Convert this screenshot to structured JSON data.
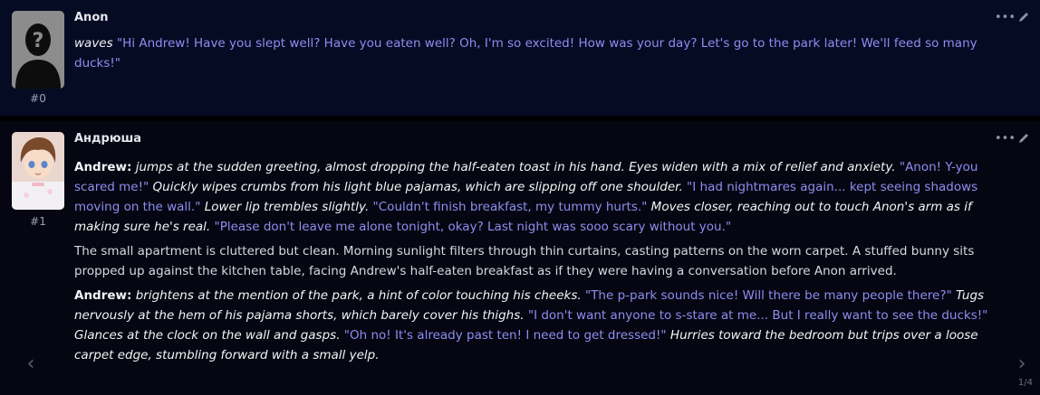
{
  "colors": {
    "user_bg": "#060b24",
    "char_bg": "#050611",
    "quote": "#8f8df0",
    "text": "#d5d8e0"
  },
  "messages": [
    {
      "name": "Anon",
      "number": "#0",
      "avatar_icon": "unknown-user-silhouette-icon",
      "tools": [
        "more-icon",
        "edit-pencil-icon"
      ],
      "segments": [
        [
          {
            "style": "em",
            "text": "waves"
          },
          {
            "style": "plain",
            "text": " "
          },
          {
            "style": "q",
            "text": "\"Hi Andrew! Have you slept well? Have you eaten well? Oh, I'm so excited! How was your day? Let's go to the park later! We'll feed so many ducks!\""
          }
        ]
      ]
    },
    {
      "name": "Андрюша",
      "number": "#1",
      "avatar_icon": "anime-boy-avatar-icon",
      "tools": [
        "more-icon",
        "edit-pencil-icon"
      ],
      "segments": [
        [
          {
            "style": "b",
            "text": "Andrew:"
          },
          {
            "style": "em",
            "text": " jumps at the sudden greeting, almost dropping the half-eaten toast in his hand. Eyes widen with a mix of relief and anxiety. "
          },
          {
            "style": "q",
            "text": "\"Anon! Y-you scared me!\""
          },
          {
            "style": "em",
            "text": " Quickly wipes crumbs from his light blue pajamas, which are slipping off one shoulder. "
          },
          {
            "style": "q",
            "text": "\"I had nightmares again... kept seeing shadows moving on the wall.\""
          },
          {
            "style": "em",
            "text": " Lower lip trembles slightly. "
          },
          {
            "style": "q",
            "text": "\"Couldn't finish breakfast, my tummy hurts.\""
          },
          {
            "style": "em",
            "text": " Moves closer, reaching out to touch Anon's arm as if making sure he's real. "
          },
          {
            "style": "q",
            "text": "\"Please don't leave me alone tonight, okay? Last night was sooo scary without you.\""
          }
        ],
        [
          {
            "style": "plain",
            "text": "The small apartment is cluttered but clean. Morning sunlight filters through thin curtains, casting patterns on the worn carpet. A stuffed bunny sits propped up against the kitchen table, facing Andrew's half-eaten breakfast as if they were having a conversation before Anon arrived."
          }
        ],
        [
          {
            "style": "b",
            "text": "Andrew:"
          },
          {
            "style": "em",
            "text": " brightens at the mention of the park, a hint of color touching his cheeks. "
          },
          {
            "style": "q",
            "text": "\"The p-park sounds nice! Will there be many people there?\""
          },
          {
            "style": "em",
            "text": " Tugs nervously at the hem of his pajama shorts, which barely cover his thighs. "
          },
          {
            "style": "q",
            "text": "\"I don't want anyone to s-stare at me... But I really want to see the ducks!\""
          },
          {
            "style": "em",
            "text": " Glances at the clock on the wall and gasps. "
          },
          {
            "style": "q",
            "text": "\"Oh no! It's already past ten! I need to get dressed!\""
          },
          {
            "style": "em",
            "text": " Hurries toward the bedroom but trips over a loose carpet edge, stumbling forward with a small yelp."
          }
        ]
      ]
    }
  ],
  "swipe": {
    "left_icon": "chevron-left-icon",
    "right_icon": "chevron-right-icon",
    "left_glyph": "‹",
    "right_glyph": "›",
    "counter": "1/4"
  }
}
